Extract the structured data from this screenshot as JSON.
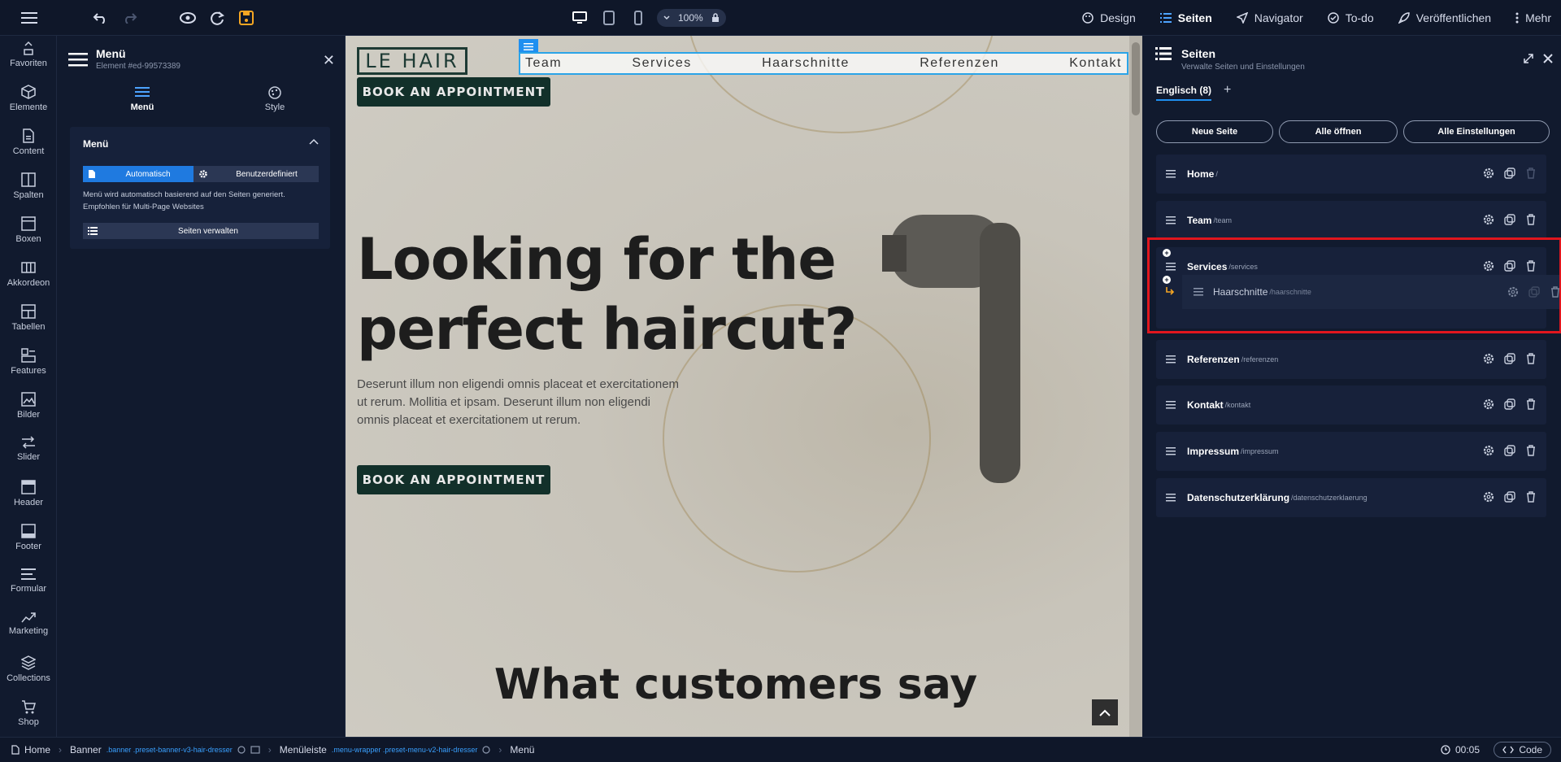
{
  "topbar": {
    "zoom": "100%",
    "nav": [
      {
        "label": "Design",
        "icon": "palette-icon"
      },
      {
        "label": "Seiten",
        "icon": "list-icon",
        "active": true
      },
      {
        "label": "Navigator",
        "icon": "navigation-icon"
      },
      {
        "label": "To-do",
        "icon": "check-circle-icon"
      },
      {
        "label": "Veröffentlichen",
        "icon": "rocket-icon"
      },
      {
        "label": "Mehr",
        "icon": "more-vertical-icon"
      }
    ]
  },
  "left_sidebar": {
    "items": [
      {
        "label": "Favoriten",
        "icon": "favorites-icon"
      },
      {
        "label": "Elemente",
        "icon": "cube-icon"
      },
      {
        "label": "Content",
        "icon": "file-icon"
      },
      {
        "label": "Spalten",
        "icon": "columns-icon"
      },
      {
        "label": "Boxen",
        "icon": "box-icon"
      },
      {
        "label": "Akkordeon",
        "icon": "accordion-icon"
      },
      {
        "label": "Tabellen",
        "icon": "table-icon"
      },
      {
        "label": "Features",
        "icon": "features-icon"
      },
      {
        "label": "Bilder",
        "icon": "image-icon"
      },
      {
        "label": "Slider",
        "icon": "slider-icon"
      },
      {
        "label": "Header",
        "icon": "header-icon"
      },
      {
        "label": "Footer",
        "icon": "footer-icon"
      },
      {
        "label": "Formular",
        "icon": "form-icon"
      },
      {
        "label": "Marketing",
        "icon": "trend-icon"
      },
      {
        "label": "Collections",
        "icon": "layers-icon"
      },
      {
        "label": "Shop",
        "icon": "cart-icon"
      }
    ]
  },
  "menu_panel": {
    "title": "Menü",
    "subtitle": "Element #ed-99573389",
    "tabs": [
      {
        "label": "Menü"
      },
      {
        "label": "Style"
      }
    ],
    "section_title": "Menü",
    "mode_auto": "Automatisch",
    "mode_custom": "Benutzerdefiniert",
    "note_line1": "Menü wird automatisch basierend auf den Seiten generiert.",
    "note_line2": "Empfohlen für Multi-Page Websites",
    "manage_button": "Seiten verwalten"
  },
  "preview": {
    "logo": "LE HAIR",
    "nav": [
      "Team",
      "Services",
      "Haarschnitte",
      "Referenzen",
      "Kontakt"
    ],
    "book_button": "BOOK AN APPOINTMENT",
    "hero_title": "Looking for the perfect haircut?",
    "hero_text": "Deserunt illum non eligendi omnis placeat et exercitationem ut rerum. Mollitia et ipsam. Deserunt illum non eligendi omnis placeat et exercitationem ut rerum.",
    "section_title": "What customers say"
  },
  "pages_panel": {
    "title": "Seiten",
    "subtitle": "Verwalte Seiten und Einstellungen",
    "language_tab": "Englisch (8)",
    "buttons": {
      "new": "Neue Seite",
      "open_all": "Alle öffnen",
      "all_settings": "Alle Einstellungen"
    },
    "pages": [
      {
        "name": "Home",
        "slug": "/"
      },
      {
        "name": "Team",
        "slug": "/team"
      },
      {
        "name": "Services",
        "slug": "/services"
      },
      {
        "name": "Referenzen",
        "slug": "/referenzen"
      },
      {
        "name": "Kontakt",
        "slug": "/kontakt"
      },
      {
        "name": "Impressum",
        "slug": "/impressum"
      },
      {
        "name": "Datenschutzerklärung",
        "slug": "/datenschutzerklaerung"
      }
    ],
    "dragged_page": {
      "name": "Haarschnitte",
      "slug": "/haarschnitte"
    }
  },
  "statusbar": {
    "crumbs": [
      {
        "label": "Home",
        "class": ""
      },
      {
        "label": "Banner",
        "class": ".banner .preset-banner-v3-hair-dresser"
      },
      {
        "label": "Menüleiste",
        "class": ".menu-wrapper .preset-menu-v2-hair-dresser"
      },
      {
        "label": "Menü",
        "class": ""
      }
    ],
    "time": "00:05",
    "code_button": "Code"
  },
  "colors": {
    "accent": "#1f8ff0",
    "drop_highlight": "#e0161e",
    "panel_bg": "#111a2e",
    "save_icon": "#f5a623"
  }
}
